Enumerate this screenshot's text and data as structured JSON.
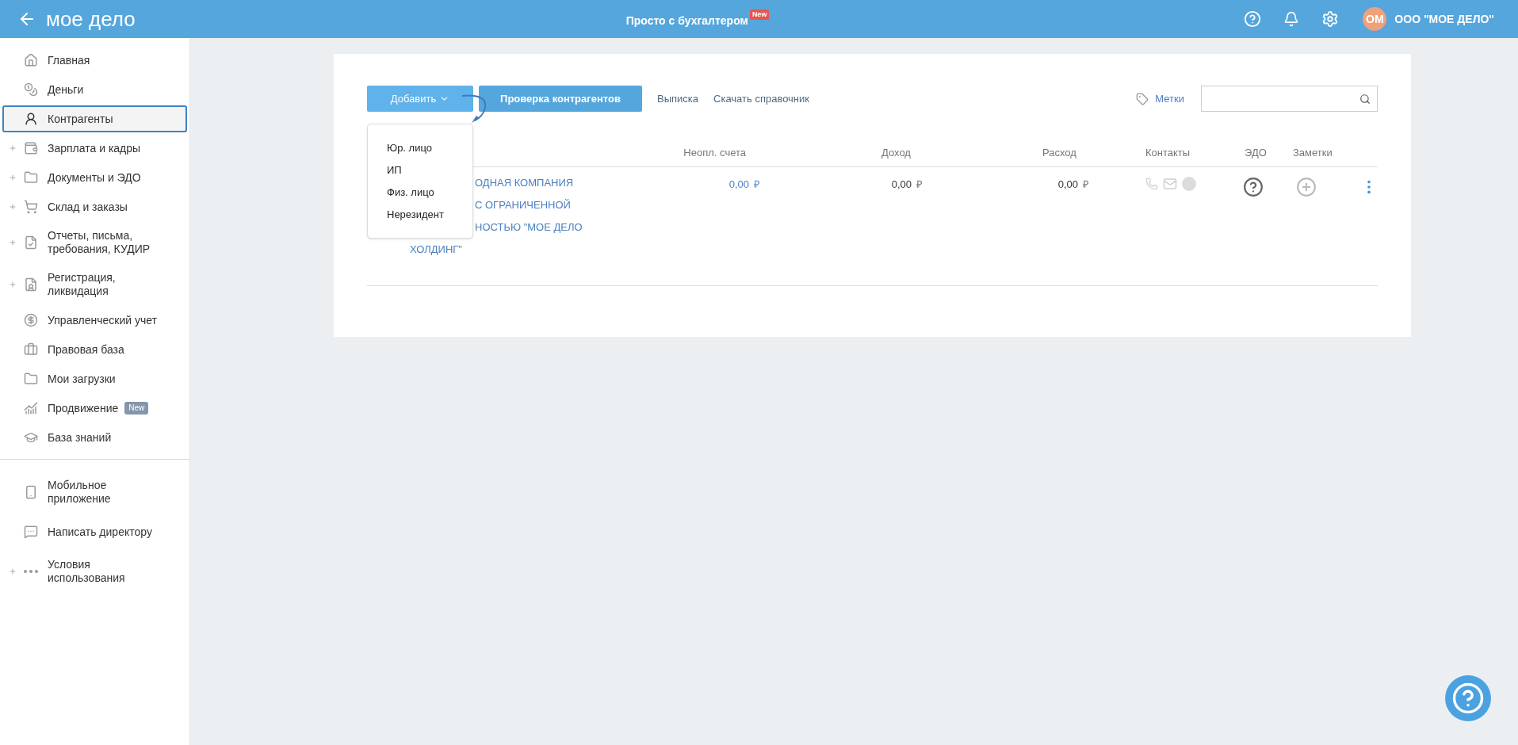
{
  "header": {
    "logo": "мое дело",
    "title": "Просто с бухгалтером",
    "title_badge": "New",
    "avatar": "ОМ",
    "organization": "ООО \"МОЕ ДЕЛО\""
  },
  "sidebar": {
    "items": [
      {
        "label": "Главная",
        "expandable": false,
        "selected": false
      },
      {
        "label": "Деньги",
        "expandable": false,
        "selected": false
      },
      {
        "label": "Контрагенты",
        "expandable": false,
        "selected": true
      },
      {
        "label": "Зарплата и кадры",
        "expandable": true,
        "selected": false
      },
      {
        "label": "Документы и ЭДО",
        "expandable": true,
        "selected": false
      },
      {
        "label": "Склад и заказы",
        "expandable": true,
        "selected": false
      },
      {
        "label": "Отчеты, письма, требования, КУДИР",
        "expandable": true,
        "selected": false
      },
      {
        "label": "Регистрация, ликвидация",
        "expandable": true,
        "selected": false
      },
      {
        "label": "Управленческий учет",
        "expandable": false,
        "selected": false
      },
      {
        "label": "Правовая база",
        "expandable": false,
        "selected": false
      },
      {
        "label": "Мои загрузки",
        "expandable": false,
        "selected": false
      },
      {
        "label": "Продвижение",
        "expandable": false,
        "selected": false,
        "badge": "New"
      },
      {
        "label": "База знаний",
        "expandable": false,
        "selected": false
      }
    ],
    "bottom_items": [
      {
        "label": "Мобильное приложение",
        "expandable": false
      },
      {
        "label": "Написать директору",
        "expandable": false
      },
      {
        "label": "Условия использования",
        "expandable": true
      }
    ]
  },
  "toolbar": {
    "add_button": "Добавить",
    "check_button": "Проверка контрагентов",
    "links": [
      "Выписка",
      "Скачать справочник"
    ],
    "tags_link": "Метки"
  },
  "add_menu": {
    "items": [
      "Юр. лицо",
      "ИП",
      "Физ. лицо",
      "Нерезидент"
    ]
  },
  "table": {
    "columns": [
      "Неопл. счета",
      "Доход",
      "Расход",
      "Контакты",
      "ЭДО",
      "Заметки"
    ],
    "rows": [
      {
        "name_lines": [
          "ОДНАЯ КОМПАНИЯ",
          "С ОГРАНИЧЕННОЙ",
          "НОСТЬЮ \"МОЕ ДЕЛО",
          "ХОЛДИНГ\""
        ],
        "unpaid": {
          "amount": "0,00",
          "currency": "₽"
        },
        "income": {
          "amount": "0,00",
          "currency": "₽"
        },
        "expense": {
          "amount": "0,00",
          "currency": "₽"
        }
      }
    ]
  }
}
